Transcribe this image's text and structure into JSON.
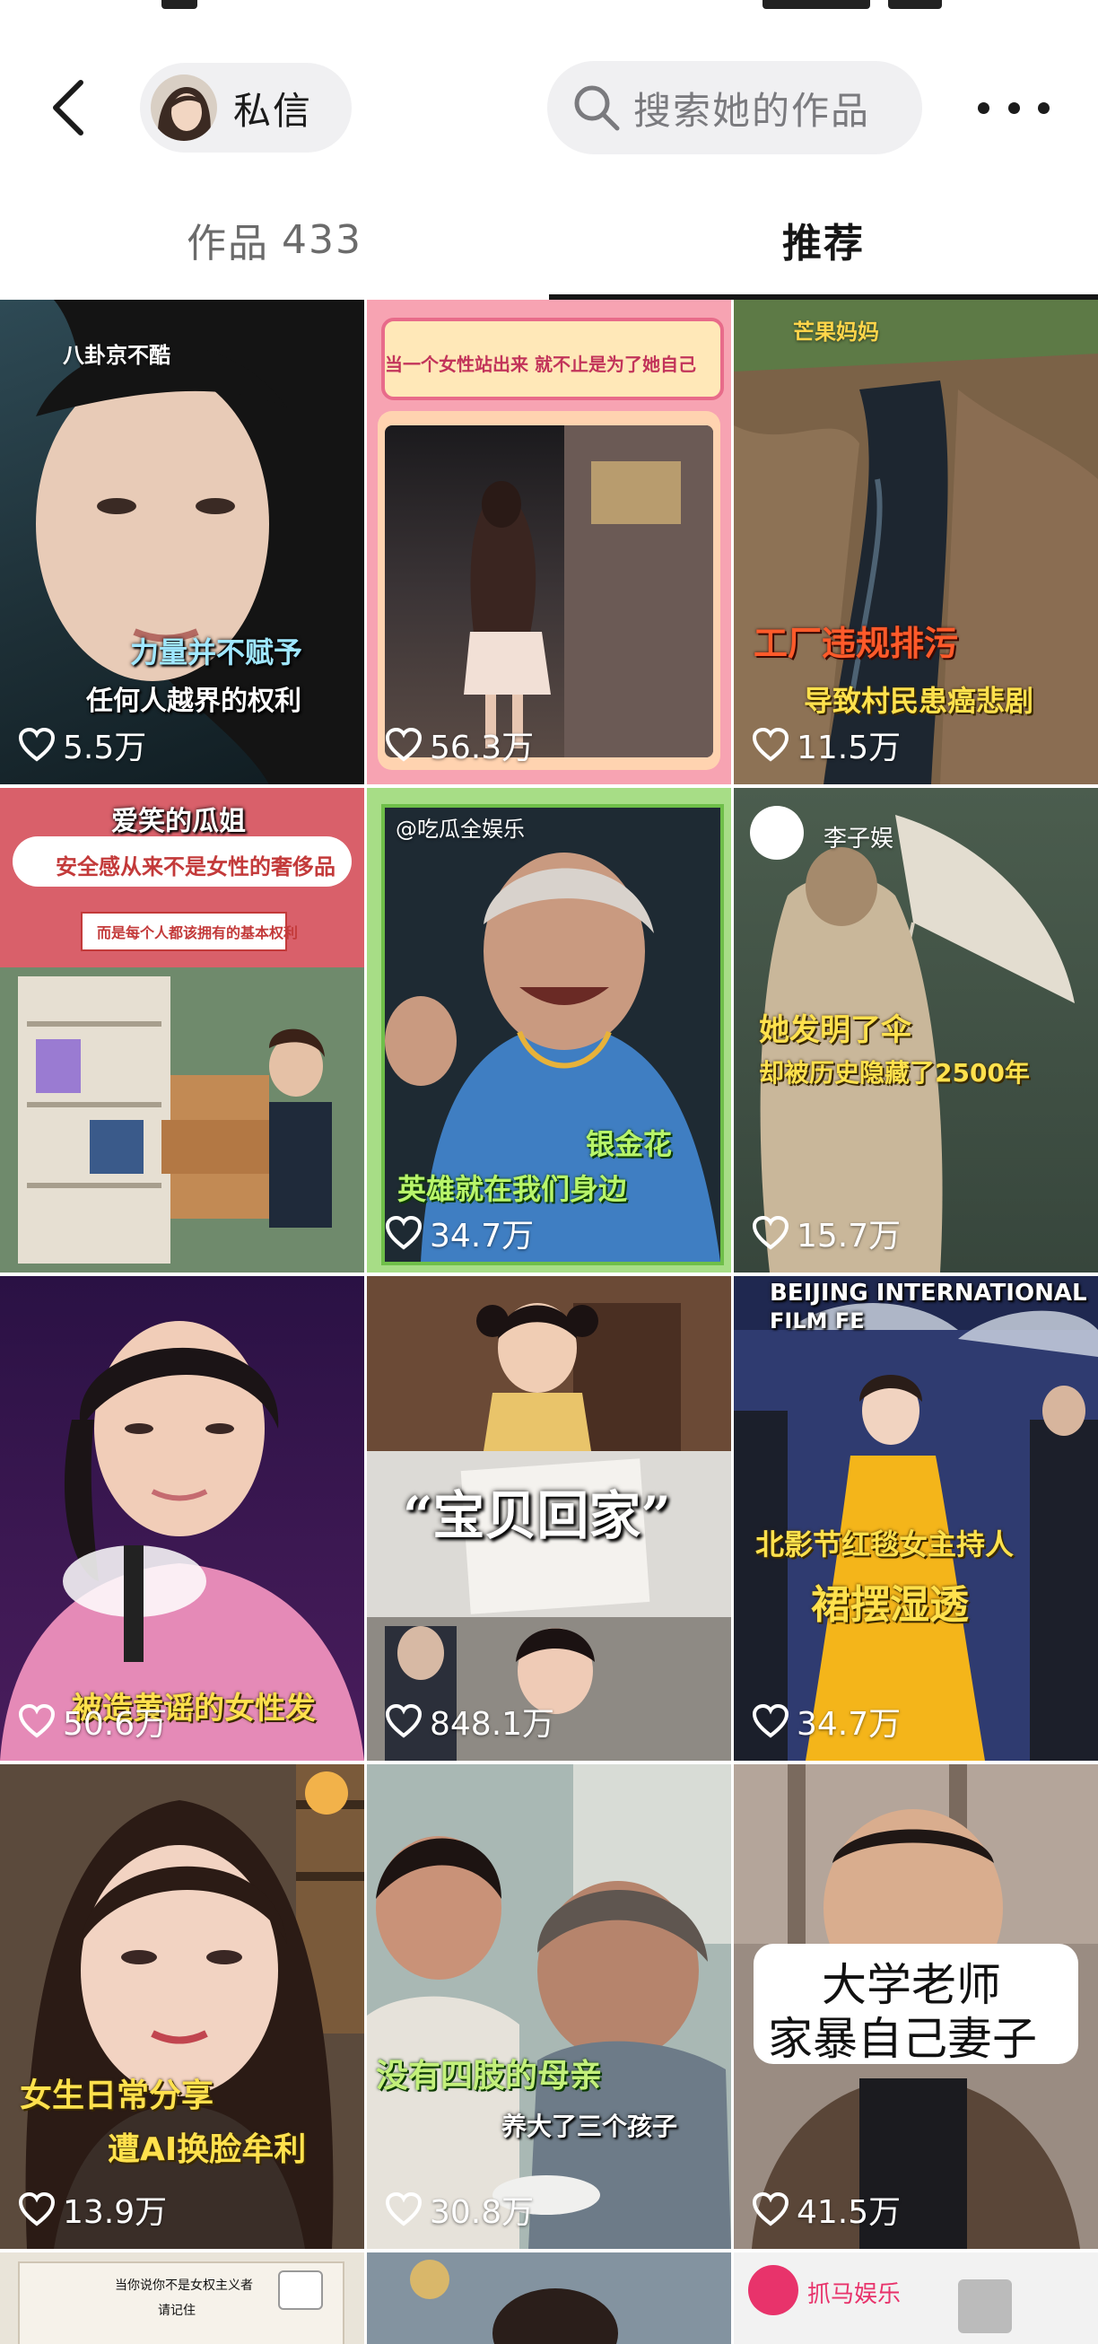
{
  "header": {
    "dm_label": "私信",
    "search_placeholder": "搜索她的作品"
  },
  "tabs": [
    {
      "label": "作品",
      "count": "433"
    },
    {
      "label": "推荐"
    }
  ],
  "grid": {
    "items": [
      {
        "likes": "5.5万",
        "badge": "八卦京不酷",
        "caption": [
          "力量并不赋予",
          "任何人越界的权利"
        ]
      },
      {
        "likes": "56.3万",
        "caption": [
          "当一个女性站出来 就不止是为了她自己"
        ]
      },
      {
        "likes": "11.5万",
        "badge": "芒果妈妈",
        "caption": [
          "工厂违规排污",
          "导致村民患癌悲剧"
        ]
      },
      {
        "likes": "",
        "caption": [
          "爱笑的瓜姐",
          "安全感从来不是女性的奢侈品",
          "而是每个人都该拥有的基本权利"
        ]
      },
      {
        "likes": "34.7万",
        "badge": "@吃瓜全娱乐",
        "caption": [
          "银金花",
          "英雄就在我们身边"
        ]
      },
      {
        "likes": "15.7万",
        "badge": "李子娱",
        "caption": [
          "她发明了伞",
          "却被历史隐藏了2500年"
        ]
      },
      {
        "likes": "50.6万",
        "caption": [
          "被造黄谣的女性发"
        ]
      },
      {
        "likes": "848.1万",
        "caption": [
          "“宝贝回家”"
        ]
      },
      {
        "likes": "34.7万",
        "caption": [
          "BEIJING INTERNATIONAL",
          "FILM FE",
          "北影节红毯女主持人",
          "裙摆湿透"
        ]
      },
      {
        "likes": "13.9万",
        "caption": [
          "女生日常分享",
          "遭AI换脸牟利"
        ]
      },
      {
        "likes": "30.8万",
        "caption": [
          "没有四肢的母亲",
          "养大了三个孩子"
        ]
      },
      {
        "likes": "41.5万",
        "caption": [
          "大学老师",
          "家暴自己妻子"
        ]
      },
      {
        "likes": "",
        "caption": [
          "当你说你不是女权主义者",
          "请记住"
        ]
      },
      {
        "likes": "",
        "caption": []
      },
      {
        "likes": "",
        "badge": "抓马娱乐",
        "caption": []
      }
    ]
  },
  "colors": {
    "accent_text": "#161616",
    "inactive_tab": "#6b6b6b",
    "pill_bg": "#f0f0f2"
  },
  "icons": [
    "back-chevron-icon",
    "search-icon",
    "more-dots-icon",
    "heart-icon"
  ]
}
